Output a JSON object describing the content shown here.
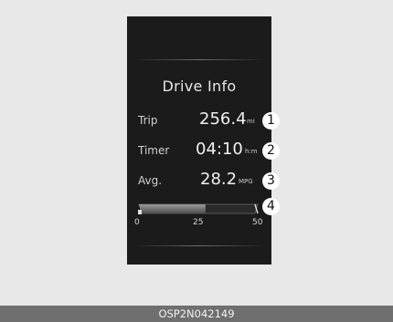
{
  "screen": {
    "title": "Drive Info",
    "rows": [
      {
        "label": "Trip",
        "value": "256.4",
        "unit": "mi",
        "marker": "1"
      },
      {
        "label": "Timer",
        "value": "04:10",
        "unit": "h:m",
        "marker": "2"
      },
      {
        "label": "Avg.",
        "value": "28.2",
        "unit": "MPG",
        "marker": "3"
      }
    ],
    "gauge": {
      "marker": "4",
      "min": "0",
      "mid": "25",
      "max": "50",
      "fill_fraction": 0.56
    }
  },
  "footer": {
    "code": "OSP2N042149"
  },
  "colors": {
    "panel": "#1b1b1b",
    "page": "#e8e8e8",
    "footer": "#6f6f6f"
  }
}
